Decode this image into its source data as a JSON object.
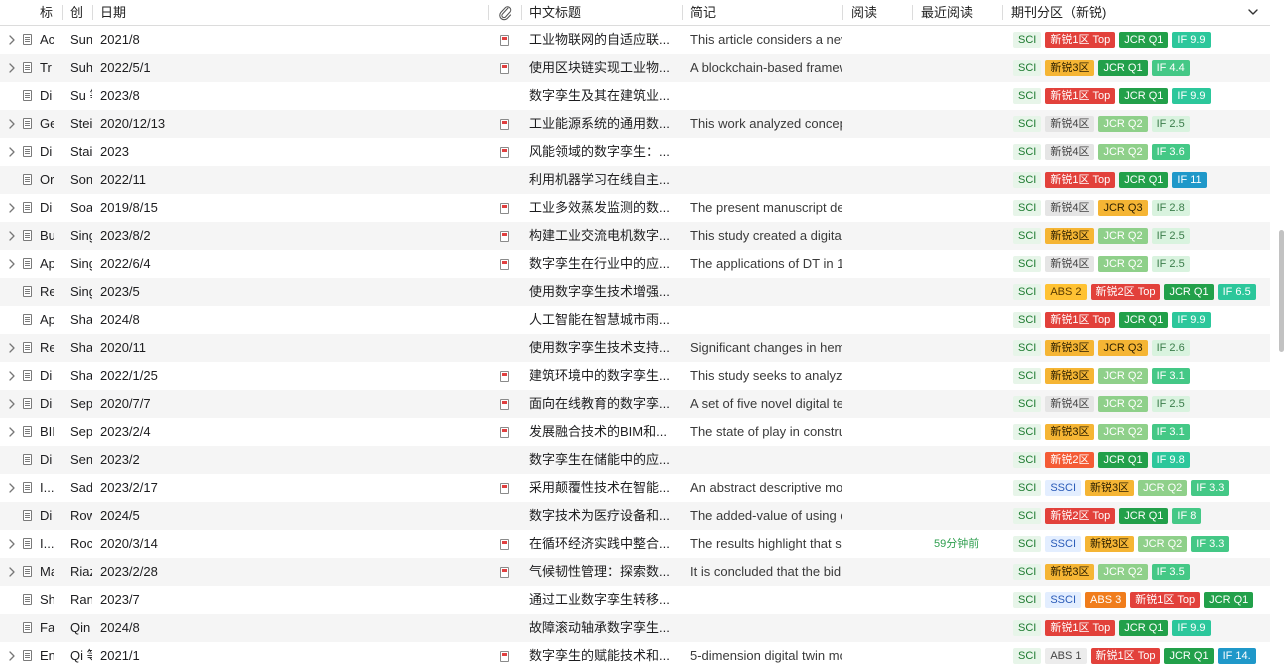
{
  "header": {
    "col_title": "标",
    "col_creator": "创",
    "col_date": "日期",
    "col_attach_icon": "paperclip-icon",
    "col_cn_title": "中文标题",
    "col_abstract": "简记",
    "col_read": "阅读",
    "col_last_read": "最近阅读",
    "col_journal": "期刊分区（新锐)",
    "dropdown_icon": "chevron-down-icon"
  },
  "rows": [
    {
      "title": "Ac",
      "creator": "Sun",
      "date": "2021/8",
      "cn": "工业物联网的自适应联...",
      "abs": "This article considers a nev",
      "last": "",
      "pdf": true,
      "twisty": true,
      "tags": [
        [
          "SCI",
          "sci"
        ],
        [
          "新锐1区 Top",
          "r1top"
        ],
        [
          "JCR Q1",
          "q1"
        ],
        [
          "IF 9.9",
          "if-hi"
        ]
      ]
    },
    {
      "title": "Tr",
      "creator": "Suh",
      "date": "2022/5/1",
      "cn": "使用区块链实现工业物...",
      "abs": "A blockchain-based framew",
      "last": "",
      "pdf": true,
      "twisty": true,
      "tags": [
        [
          "SCI",
          "sci"
        ],
        [
          "新锐3区",
          "r3"
        ],
        [
          "JCR Q1",
          "q1"
        ],
        [
          "IF 4.4",
          "if-mid"
        ]
      ]
    },
    {
      "title": "Di",
      "creator": "Su 等",
      "date": "2023/8",
      "cn": "数字孪生及其在建筑业...",
      "abs": "",
      "last": "",
      "pdf": false,
      "twisty": false,
      "tags": [
        [
          "SCI",
          "sci"
        ],
        [
          "新锐1区 Top",
          "r1top"
        ],
        [
          "JCR Q1",
          "q1"
        ],
        [
          "IF 9.9",
          "if-hi"
        ]
      ]
    },
    {
      "title": "Ge",
      "creator": "Stei",
      "date": "2020/12/13",
      "cn": "工业能源系统的通用数...",
      "abs": "This work analyzed concep",
      "last": "",
      "pdf": true,
      "twisty": true,
      "tags": [
        [
          "SCI",
          "sci"
        ],
        [
          "新锐4区",
          "r4"
        ],
        [
          "JCR Q2",
          "q2"
        ],
        [
          "IF 2.5",
          "if-lo"
        ]
      ]
    },
    {
      "title": "Di",
      "creator": "Stai",
      "date": "2023",
      "cn": "风能领域的数字孪生：...",
      "abs": "",
      "last": "",
      "pdf": true,
      "twisty": true,
      "tags": [
        [
          "SCI",
          "sci"
        ],
        [
          "新锐4区",
          "r4"
        ],
        [
          "JCR Q2",
          "q2"
        ],
        [
          "IF 3.6",
          "if-mid"
        ]
      ]
    },
    {
      "title": "Or",
      "creator": "Son",
      "date": "2022/11",
      "cn": "利用机器学习在线自主...",
      "abs": "",
      "last": "",
      "pdf": false,
      "twisty": false,
      "tags": [
        [
          "SCI",
          "sci"
        ],
        [
          "新锐1区 Top",
          "r1top"
        ],
        [
          "JCR Q1",
          "q1"
        ],
        [
          "IF 11",
          "if-blue"
        ]
      ]
    },
    {
      "title": "Di",
      "creator": "Soa",
      "date": "2019/8/15",
      "cn": "工业多效蒸发监测的数...",
      "abs": "The present manuscript de",
      "last": "",
      "pdf": true,
      "twisty": true,
      "tags": [
        [
          "SCI",
          "sci"
        ],
        [
          "新锐4区",
          "r4"
        ],
        [
          "JCR Q3",
          "q3"
        ],
        [
          "IF 2.8",
          "if-lo"
        ]
      ]
    },
    {
      "title": "Bu",
      "creator": "Sing",
      "date": "2023/8/2",
      "cn": "构建工业交流电机数字...",
      "abs": "This study created a digital",
      "last": "",
      "pdf": true,
      "twisty": true,
      "tags": [
        [
          "SCI",
          "sci"
        ],
        [
          "新锐3区",
          "r3"
        ],
        [
          "JCR Q2",
          "q2"
        ],
        [
          "IF 2.5",
          "if-lo"
        ]
      ]
    },
    {
      "title": "Ap",
      "creator": "Sing",
      "date": "2022/6/4",
      "cn": "数字孪生在行业中的应...",
      "abs": "The applications of DT in 13",
      "last": "",
      "pdf": true,
      "twisty": true,
      "tags": [
        [
          "SCI",
          "sci"
        ],
        [
          "新锐4区",
          "r4"
        ],
        [
          "JCR Q2",
          "q2"
        ],
        [
          "IF 2.5",
          "if-lo"
        ]
      ]
    },
    {
      "title": "Re",
      "creator": "Sing",
      "date": "2023/5",
      "cn": "使用数字孪生技术增强...",
      "abs": "",
      "last": "",
      "pdf": false,
      "twisty": false,
      "tags": [
        [
          "SCI",
          "sci"
        ],
        [
          "ABS 2",
          "abs2"
        ],
        [
          "新锐2区 Top",
          "r2top"
        ],
        [
          "JCR Q1",
          "q1"
        ],
        [
          "IF 6.5",
          "if-hi"
        ]
      ]
    },
    {
      "title": "Ap",
      "creator": "Sha",
      "date": "2024/8",
      "cn": "人工智能在智慧城市雨...",
      "abs": "",
      "last": "",
      "pdf": false,
      "twisty": false,
      "tags": [
        [
          "SCI",
          "sci"
        ],
        [
          "新锐1区 Top",
          "r1top"
        ],
        [
          "JCR Q1",
          "q1"
        ],
        [
          "IF 9.9",
          "if-hi"
        ]
      ]
    },
    {
      "title": "Re",
      "creator": "Sha",
      "date": "2020/11",
      "cn": "使用数字孪生技术支持...",
      "abs": "Significant changes in hem",
      "last": "",
      "pdf": false,
      "twisty": true,
      "tags": [
        [
          "SCI",
          "sci"
        ],
        [
          "新锐3区",
          "r3"
        ],
        [
          "JCR Q3",
          "q3"
        ],
        [
          "IF 2.6",
          "if-lo"
        ]
      ]
    },
    {
      "title": "Di",
      "creator": "Sha",
      "date": "2022/1/25",
      "cn": "建筑环境中的数字孪生...",
      "abs": "This study seeks to analyze",
      "last": "",
      "pdf": true,
      "twisty": true,
      "tags": [
        [
          "SCI",
          "sci"
        ],
        [
          "新锐3区",
          "r3"
        ],
        [
          "JCR Q2",
          "q2"
        ],
        [
          "IF 3.1",
          "if-mid"
        ]
      ]
    },
    {
      "title": "Di",
      "creator": "Sep",
      "date": "2020/7/7",
      "cn": "面向在线教育的数字孪...",
      "abs": "A set of five novel digital te",
      "last": "",
      "pdf": true,
      "twisty": true,
      "tags": [
        [
          "SCI",
          "sci"
        ],
        [
          "新锐4区",
          "r4"
        ],
        [
          "JCR Q2",
          "q2"
        ],
        [
          "IF 2.5",
          "if-lo"
        ]
      ]
    },
    {
      "title": "BII",
      "creator": "Sep",
      "date": "2023/2/4",
      "cn": "发展融合技术的BIM和...",
      "abs": "The state of play in constru",
      "last": "",
      "pdf": true,
      "twisty": true,
      "tags": [
        [
          "SCI",
          "sci"
        ],
        [
          "新锐3区",
          "r3"
        ],
        [
          "JCR Q2",
          "q2"
        ],
        [
          "IF 3.1",
          "if-mid"
        ]
      ]
    },
    {
      "title": "Di",
      "creator": "Sen",
      "date": "2023/2",
      "cn": "数字孪生在储能中的应...",
      "abs": "",
      "last": "",
      "pdf": false,
      "twisty": false,
      "tags": [
        [
          "SCI",
          "sci"
        ],
        [
          "新锐2区",
          "r2"
        ],
        [
          "JCR Q1",
          "q1"
        ],
        [
          "IF 9.8",
          "if-hi"
        ]
      ]
    },
    {
      "title": "I...",
      "creator": "Sad",
      "date": "2023/2/17",
      "cn": "采用颠覆性技术在智能...",
      "abs": "An abstract descriptive mo",
      "last": "",
      "pdf": true,
      "twisty": true,
      "tags": [
        [
          "SCI",
          "sci"
        ],
        [
          "SSCI",
          "ssci"
        ],
        [
          "新锐3区",
          "r3"
        ],
        [
          "JCR Q2",
          "q2"
        ],
        [
          "IF 3.3",
          "if-mid"
        ]
      ]
    },
    {
      "title": "Di",
      "creator": "Row",
      "date": "2024/5",
      "cn": "数字技术为医疗设备和...",
      "abs": "The added-value of using d",
      "last": "",
      "pdf": false,
      "twisty": false,
      "tags": [
        [
          "SCI",
          "sci"
        ],
        [
          "新锐2区 Top",
          "r2top"
        ],
        [
          "JCR Q1",
          "q1"
        ],
        [
          "IF 8",
          "if-mid"
        ]
      ]
    },
    {
      "title": "I...",
      "creator": "Roc",
      "date": "2020/3/14",
      "cn": "在循环经济实践中整合...",
      "abs": "The results highlight that se",
      "last": "59分钟前",
      "pdf": true,
      "twisty": true,
      "tags": [
        [
          "SCI",
          "sci"
        ],
        [
          "SSCI",
          "ssci"
        ],
        [
          "新锐3区",
          "r3"
        ],
        [
          "JCR Q2",
          "q2"
        ],
        [
          "IF 3.3",
          "if-mid"
        ]
      ]
    },
    {
      "title": "Ma",
      "creator": "Riaz",
      "date": "2023/2/28",
      "cn": "气候韧性管理：探索数...",
      "abs": "It is concluded that the bid",
      "last": "",
      "pdf": true,
      "twisty": true,
      "tags": [
        [
          "SCI",
          "sci"
        ],
        [
          "新锐3区",
          "r3"
        ],
        [
          "JCR Q2",
          "q2"
        ],
        [
          "IF 3.5",
          "if-mid"
        ]
      ]
    },
    {
      "title": "Sh",
      "creator": "Ran",
      "date": "2023/7",
      "cn": "通过工业数字孪生转移...",
      "abs": "",
      "last": "",
      "pdf": false,
      "twisty": false,
      "tags": [
        [
          "SCI",
          "sci"
        ],
        [
          "SSCI",
          "ssci"
        ],
        [
          "ABS 3",
          "abs3"
        ],
        [
          "新锐1区 Top",
          "r1top"
        ],
        [
          "JCR Q1",
          "q1"
        ]
      ]
    },
    {
      "title": "Fa",
      "creator": "Qin",
      "date": "2024/8",
      "cn": "故障滚动轴承数字孪生...",
      "abs": "",
      "last": "",
      "pdf": false,
      "twisty": false,
      "tags": [
        [
          "SCI",
          "sci"
        ],
        [
          "新锐1区 Top",
          "r1top"
        ],
        [
          "JCR Q1",
          "q1"
        ],
        [
          "IF 9.9",
          "if-hi"
        ]
      ]
    },
    {
      "title": "En",
      "creator": "Qi 等",
      "date": "2021/1",
      "cn": "数字孪生的赋能技术和...",
      "abs": "5-dimension digital twin mo",
      "last": "",
      "pdf": true,
      "twisty": true,
      "tags": [
        [
          "SCI",
          "sci"
        ],
        [
          "ABS 1",
          "abs1"
        ],
        [
          "新锐1区 Top",
          "r1top"
        ],
        [
          "JCR Q1",
          "q1"
        ],
        [
          "IF 14.",
          "if-blue"
        ]
      ]
    }
  ]
}
